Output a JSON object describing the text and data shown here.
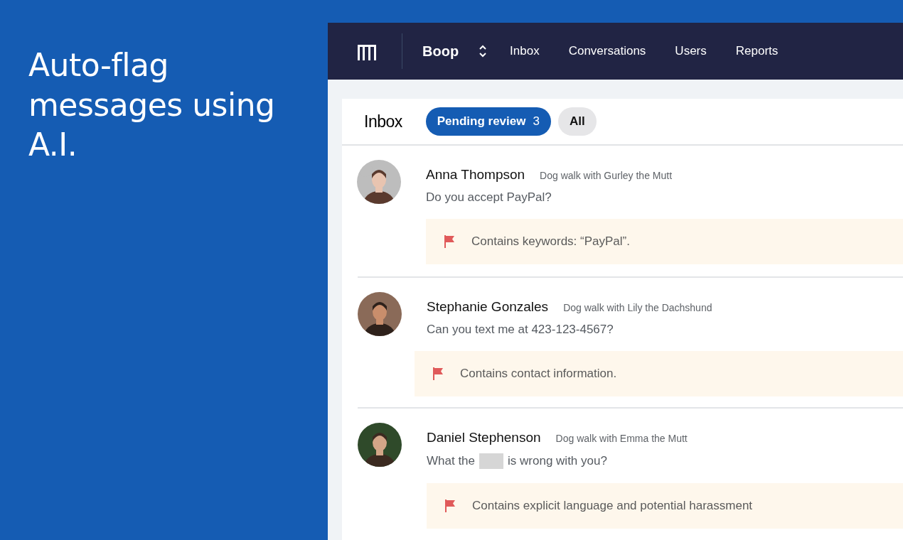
{
  "headline": "Auto-flag messages using A.I.",
  "nav": {
    "workspace": "Boop",
    "links": [
      {
        "label": "Inbox"
      },
      {
        "label": "Conversations"
      },
      {
        "label": "Users"
      },
      {
        "label": "Reports"
      }
    ]
  },
  "inbox": {
    "title": "Inbox",
    "filters": [
      {
        "label": "Pending review",
        "count": "3",
        "selected": true
      },
      {
        "label": "All",
        "selected": false
      }
    ]
  },
  "messages": [
    {
      "name": "Anna Thompson",
      "context": "Dog walk with Gurley the Mutt",
      "segments": [
        {
          "kind": "text",
          "text": "Do you accept PayPal?"
        }
      ],
      "flag": "Contains keywords: “PayPal”.",
      "indented": false
    },
    {
      "name": "Stephanie Gonzales",
      "context": "Dog walk with Lily the Dachshund",
      "segments": [
        {
          "kind": "text",
          "text": "Can you text me at 423-123-4567?"
        }
      ],
      "flag": "Contains contact information.",
      "indented": true
    },
    {
      "name": "Daniel Stephenson",
      "context": "Dog walk with Emma the Mutt",
      "segments": [
        {
          "kind": "text",
          "text": "What the"
        },
        {
          "kind": "redacted"
        },
        {
          "kind": "text",
          "text": "is wrong with you?"
        }
      ],
      "flag": "Contains explicit language and potential harassment",
      "indented": false
    }
  ]
}
